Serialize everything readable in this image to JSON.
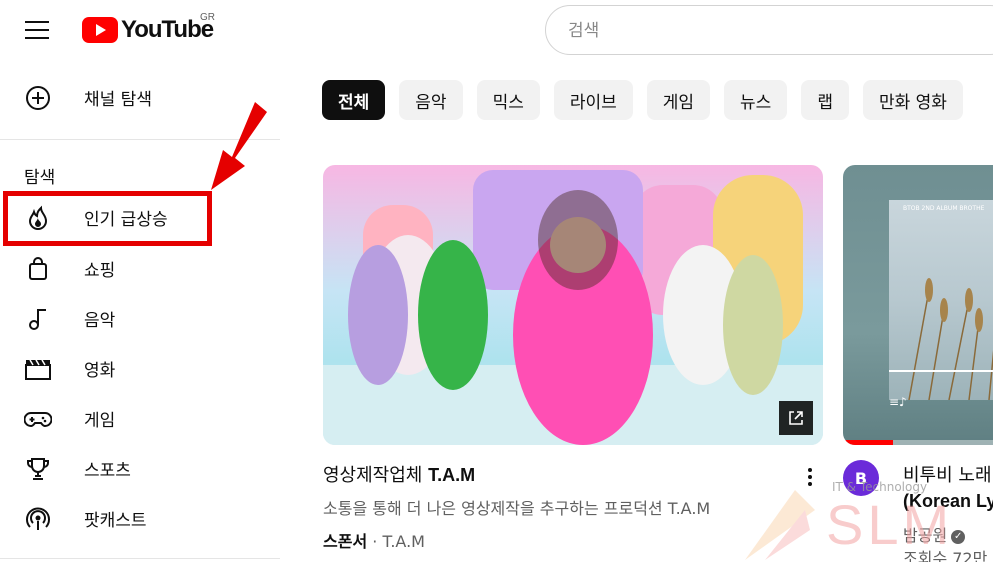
{
  "header": {
    "logo_text": "YouTube",
    "country_code": "GR",
    "search_placeholder": "검색"
  },
  "sidebar": {
    "top_items": [
      {
        "label": "채널 탐색",
        "icon": "add-circle-icon"
      }
    ],
    "explore_heading": "탐색",
    "explore_items": [
      {
        "label": "인기 급상승",
        "icon": "trending-flame-icon"
      },
      {
        "label": "쇼핑",
        "icon": "shopping-bag-icon"
      },
      {
        "label": "음악",
        "icon": "music-note-icon"
      },
      {
        "label": "영화",
        "icon": "clapperboard-icon"
      },
      {
        "label": "게임",
        "icon": "gamepad-icon"
      },
      {
        "label": "스포츠",
        "icon": "trophy-icon"
      },
      {
        "label": "팟캐스트",
        "icon": "podcast-icon"
      }
    ]
  },
  "chips": [
    "전체",
    "음악",
    "믹스",
    "라이브",
    "게임",
    "뉴스",
    "랩",
    "만화 영화"
  ],
  "videos": [
    {
      "title_prefix": "영상제작업체 ",
      "title_bold": "T.A.M",
      "description": "소통을 통해 더 나은 영상제작을 추구하는 프로덕션 T.A.M",
      "sponsor_label": "스폰서",
      "separator": " · ",
      "channel": "T.A.M"
    },
    {
      "title_line1": "비투비 노래",
      "title_line2": "(Korean Ly",
      "channel": "밤공원",
      "views": "조회수 72만",
      "thumb_small_text": "BTOB 2ND ALBUM   BROTHE",
      "avatar_letter": "B"
    }
  ],
  "watermark": {
    "text": "SLM",
    "tag": "IT & Technology"
  },
  "colors": {
    "youtube_red": "#ff0000",
    "highlight_red": "#e50000",
    "chip_bg": "#f2f2f2",
    "chip_active_bg": "#0f0f0f"
  }
}
